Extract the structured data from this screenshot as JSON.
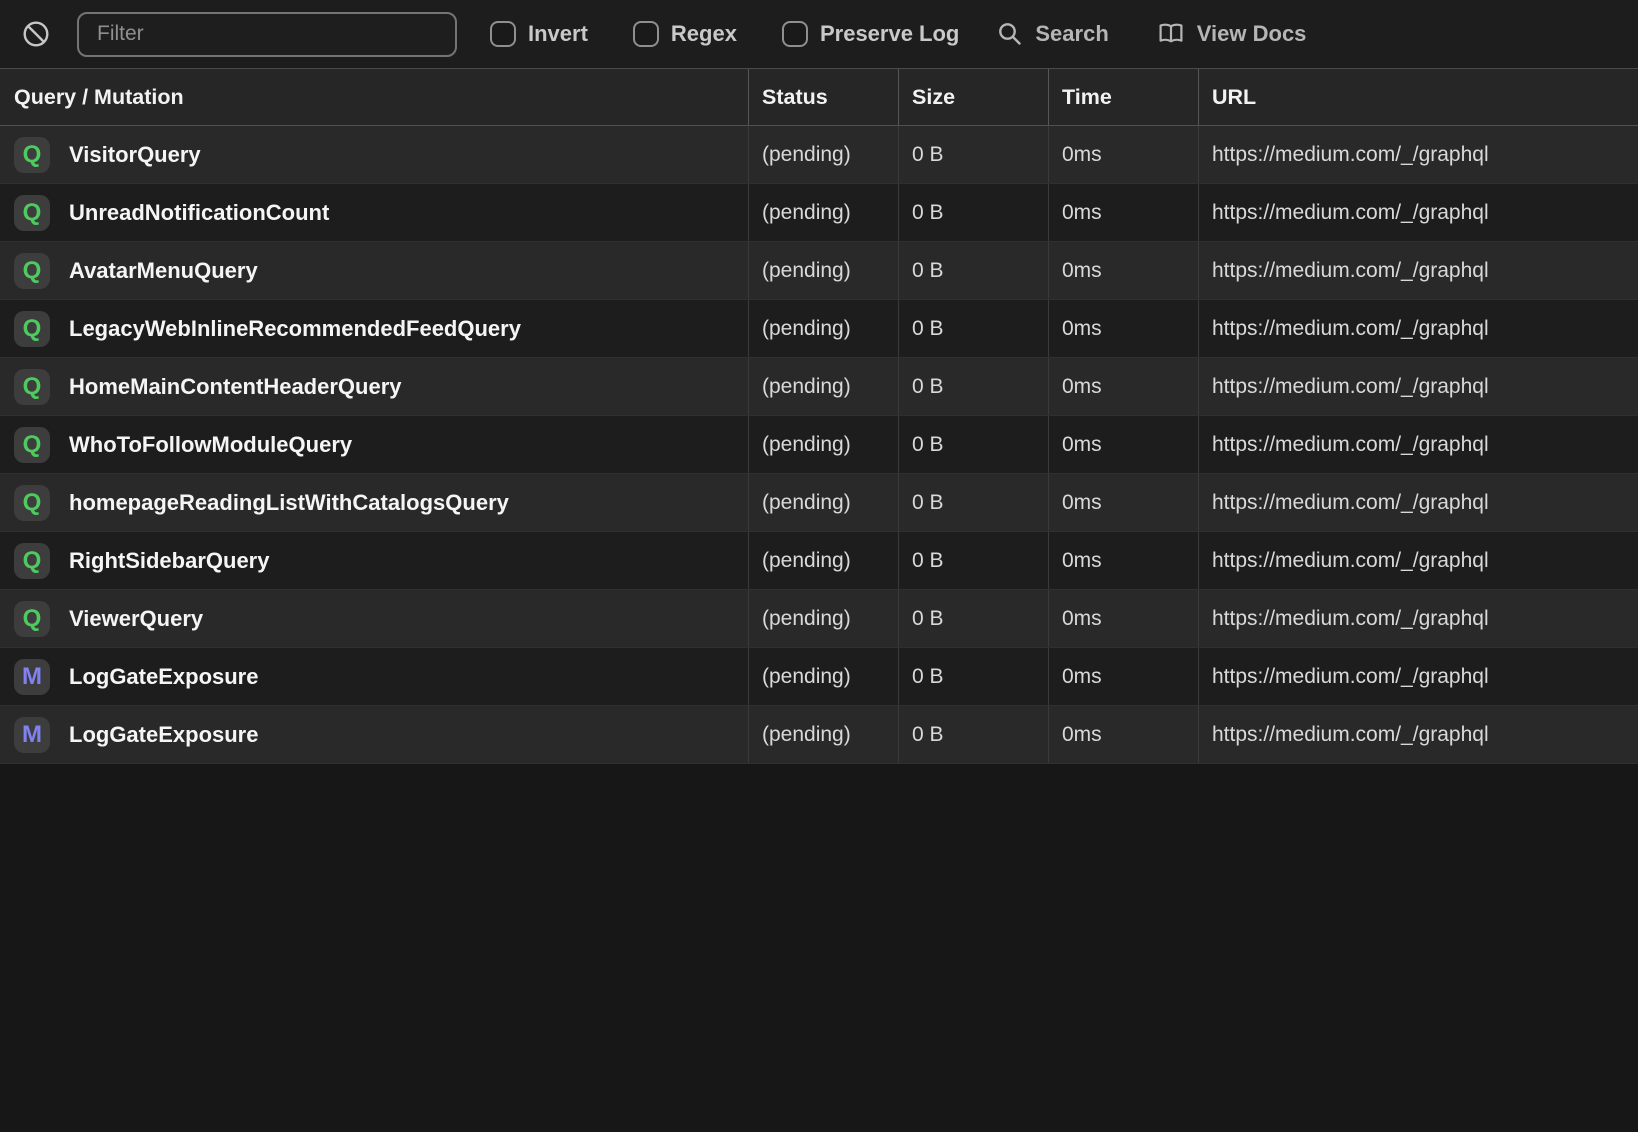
{
  "toolbar": {
    "filter_placeholder": "Filter",
    "checkboxes": [
      {
        "label": "Invert",
        "checked": false
      },
      {
        "label": "Regex",
        "checked": false
      },
      {
        "label": "Preserve Log",
        "checked": false
      }
    ],
    "actions": [
      {
        "label": "Search",
        "icon": "search-icon"
      },
      {
        "label": "View Docs",
        "icon": "book-icon"
      }
    ],
    "clear_icon": "block-icon"
  },
  "table": {
    "columns": [
      "Query / Mutation",
      "Status",
      "Size",
      "Time",
      "URL"
    ],
    "rows": [
      {
        "type": "Q",
        "name": "VisitorQuery",
        "status": "(pending)",
        "size": "0 B",
        "time": "0ms",
        "url": "https://medium.com/_/graphql"
      },
      {
        "type": "Q",
        "name": "UnreadNotificationCount",
        "status": "(pending)",
        "size": "0 B",
        "time": "0ms",
        "url": "https://medium.com/_/graphql"
      },
      {
        "type": "Q",
        "name": "AvatarMenuQuery",
        "status": "(pending)",
        "size": "0 B",
        "time": "0ms",
        "url": "https://medium.com/_/graphql"
      },
      {
        "type": "Q",
        "name": "LegacyWebInlineRecommendedFeedQuery",
        "status": "(pending)",
        "size": "0 B",
        "time": "0ms",
        "url": "https://medium.com/_/graphql"
      },
      {
        "type": "Q",
        "name": "HomeMainContentHeaderQuery",
        "status": "(pending)",
        "size": "0 B",
        "time": "0ms",
        "url": "https://medium.com/_/graphql"
      },
      {
        "type": "Q",
        "name": "WhoToFollowModuleQuery",
        "status": "(pending)",
        "size": "0 B",
        "time": "0ms",
        "url": "https://medium.com/_/graphql"
      },
      {
        "type": "Q",
        "name": "homepageReadingListWithCatalogsQuery",
        "status": "(pending)",
        "size": "0 B",
        "time": "0ms",
        "url": "https://medium.com/_/graphql"
      },
      {
        "type": "Q",
        "name": "RightSidebarQuery",
        "status": "(pending)",
        "size": "0 B",
        "time": "0ms",
        "url": "https://medium.com/_/graphql"
      },
      {
        "type": "Q",
        "name": "ViewerQuery",
        "status": "(pending)",
        "size": "0 B",
        "time": "0ms",
        "url": "https://medium.com/_/graphql"
      },
      {
        "type": "M",
        "name": "LogGateExposure",
        "status": "(pending)",
        "size": "0 B",
        "time": "0ms",
        "url": "https://medium.com/_/graphql"
      },
      {
        "type": "M",
        "name": "LogGateExposure",
        "status": "(pending)",
        "size": "0 B",
        "time": "0ms",
        "url": "https://medium.com/_/graphql"
      }
    ]
  },
  "colors": {
    "query_badge_letter": "#4ecb5f",
    "mutation_badge_letter": "#8181f0",
    "badge_background": "#3d3d3d",
    "row_light": "#292929",
    "row_dark": "#1d1d1d",
    "toolbar_background": "#1d1d1e",
    "header_background": "#262626"
  }
}
